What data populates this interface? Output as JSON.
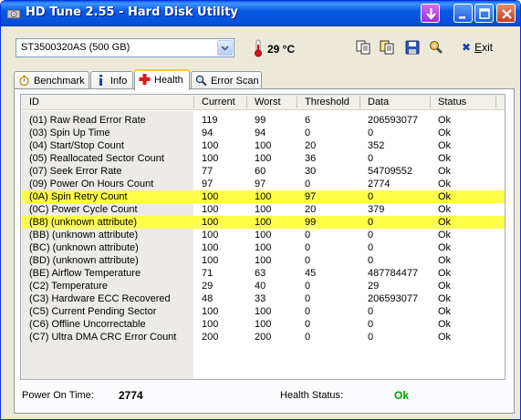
{
  "window": {
    "title": "HD Tune 2.55 - Hard Disk Utility"
  },
  "toolbar": {
    "drive": "ST3500320AS (500 GB)",
    "temperature": "29 °C",
    "exit_label_prefix": "E",
    "exit_label_rest": "xit"
  },
  "tabs": [
    {
      "label": "Benchmark",
      "icon": "stopwatch-icon"
    },
    {
      "label": "Info",
      "icon": "info-icon"
    },
    {
      "label": "Health",
      "icon": "health-cross-icon"
    },
    {
      "label": "Error Scan",
      "icon": "magnifier-icon"
    }
  ],
  "table": {
    "columns": [
      "ID",
      "Current",
      "Worst",
      "Threshold",
      "Data",
      "Status"
    ],
    "rows": [
      {
        "id": "(01) Raw Read Error Rate",
        "current": "119",
        "worst": "99",
        "threshold": "6",
        "data": "206593077",
        "status": "Ok",
        "highlight": false
      },
      {
        "id": "(03) Spin Up Time",
        "current": "94",
        "worst": "94",
        "threshold": "0",
        "data": "0",
        "status": "Ok",
        "highlight": false
      },
      {
        "id": "(04) Start/Stop Count",
        "current": "100",
        "worst": "100",
        "threshold": "20",
        "data": "352",
        "status": "Ok",
        "highlight": false
      },
      {
        "id": "(05) Reallocated Sector Count",
        "current": "100",
        "worst": "100",
        "threshold": "36",
        "data": "0",
        "status": "Ok",
        "highlight": false
      },
      {
        "id": "(07) Seek Error Rate",
        "current": "77",
        "worst": "60",
        "threshold": "30",
        "data": "54709552",
        "status": "Ok",
        "highlight": false
      },
      {
        "id": "(09) Power On Hours Count",
        "current": "97",
        "worst": "97",
        "threshold": "0",
        "data": "2774",
        "status": "Ok",
        "highlight": false
      },
      {
        "id": "(0A) Spin Retry Count",
        "current": "100",
        "worst": "100",
        "threshold": "97",
        "data": "0",
        "status": "Ok",
        "highlight": true
      },
      {
        "id": "(0C) Power Cycle Count",
        "current": "100",
        "worst": "100",
        "threshold": "20",
        "data": "379",
        "status": "Ok",
        "highlight": false
      },
      {
        "id": "(B8) (unknown attribute)",
        "current": "100",
        "worst": "100",
        "threshold": "99",
        "data": "0",
        "status": "Ok",
        "highlight": true
      },
      {
        "id": "(BB) (unknown attribute)",
        "current": "100",
        "worst": "100",
        "threshold": "0",
        "data": "0",
        "status": "Ok",
        "highlight": false
      },
      {
        "id": "(BC) (unknown attribute)",
        "current": "100",
        "worst": "100",
        "threshold": "0",
        "data": "0",
        "status": "Ok",
        "highlight": false
      },
      {
        "id": "(BD) (unknown attribute)",
        "current": "100",
        "worst": "100",
        "threshold": "0",
        "data": "0",
        "status": "Ok",
        "highlight": false
      },
      {
        "id": "(BE) Airflow Temperature",
        "current": "71",
        "worst": "63",
        "threshold": "45",
        "data": "487784477",
        "status": "Ok",
        "highlight": false
      },
      {
        "id": "(C2) Temperature",
        "current": "29",
        "worst": "40",
        "threshold": "0",
        "data": "29",
        "status": "Ok",
        "highlight": false
      },
      {
        "id": "(C3) Hardware ECC Recovered",
        "current": "48",
        "worst": "33",
        "threshold": "0",
        "data": "206593077",
        "status": "Ok",
        "highlight": false
      },
      {
        "id": "(C5) Current Pending Sector",
        "current": "100",
        "worst": "100",
        "threshold": "0",
        "data": "0",
        "status": "Ok",
        "highlight": false
      },
      {
        "id": "(C6) Offline Uncorrectable",
        "current": "100",
        "worst": "100",
        "threshold": "0",
        "data": "0",
        "status": "Ok",
        "highlight": false
      },
      {
        "id": "(C7) Ultra DMA CRC Error Count",
        "current": "200",
        "worst": "200",
        "threshold": "0",
        "data": "0",
        "status": "Ok",
        "highlight": false
      }
    ]
  },
  "footer": {
    "power_on_label": "Power On Time:",
    "power_on_value": "2774",
    "health_label": "Health Status:",
    "health_value": "Ok"
  },
  "colors": {
    "highlight": "#ffff49",
    "health_ok": "#00a000",
    "titlebar": "#0858e3"
  }
}
